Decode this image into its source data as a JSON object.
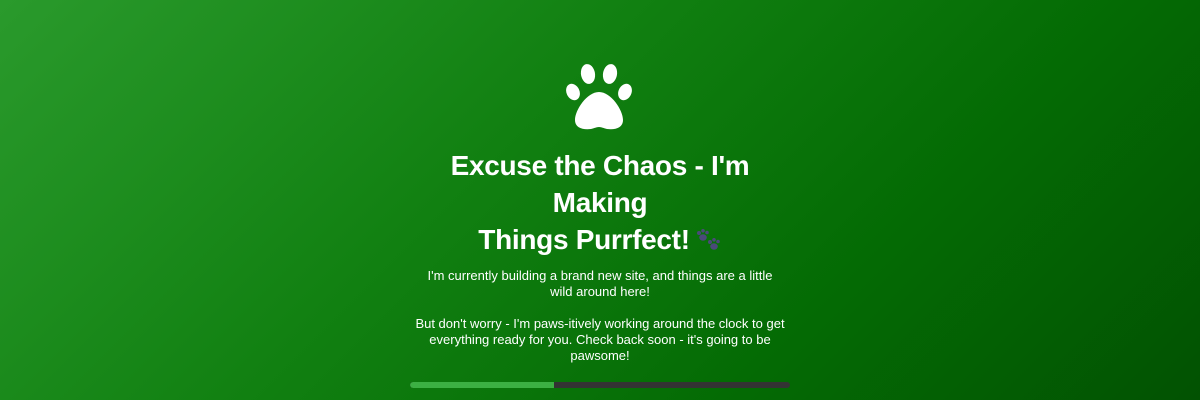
{
  "hero": {
    "icon": "paw-icon",
    "heading_line1": "Excuse the Chaos - I'm Making",
    "heading_line2": "Things Purrfect!",
    "heading_emoji": "paw-prints-icon",
    "paragraph1": "I'm currently building a brand new site, and things are a little wild around here!",
    "paragraph2": "But don't worry - I'm paws-itively working around the clock to get everything ready for you. Check back soon - it's going to be pawsome!"
  },
  "progress": {
    "value_percent": 38
  },
  "colors": {
    "background_start": "#2a9a2c",
    "background_end": "#025202",
    "progress_fill": "#3cb043",
    "progress_track": "#333333",
    "text": "#ffffff"
  }
}
